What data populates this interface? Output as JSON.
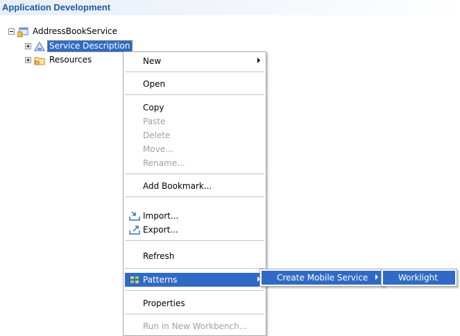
{
  "header": {
    "title": "Application Development"
  },
  "tree": {
    "root": {
      "label": "AddressBookService"
    },
    "children": [
      {
        "label": "Service Description",
        "selected": true
      },
      {
        "label": "Resources"
      }
    ]
  },
  "context_menu": {
    "new": "New",
    "open": "Open",
    "copy": "Copy",
    "paste": "Paste",
    "delete": "Delete",
    "move": "Move...",
    "rename": "Rename...",
    "add_bookmark": "Add Bookmark...",
    "import": "Import...",
    "export": "Export...",
    "refresh": "Refresh",
    "patterns": "Patterns",
    "properties": "Properties",
    "run_in_new_workbench": "Run in New Workbench..."
  },
  "patterns_submenu": {
    "create_mobile_service": "Create Mobile Service"
  },
  "mobile_submenu": {
    "worklight": "Worklight"
  },
  "colors": {
    "selection": "#316ac5",
    "header_text": "#1a5aa6",
    "disabled_text": "#a0a0a0"
  }
}
